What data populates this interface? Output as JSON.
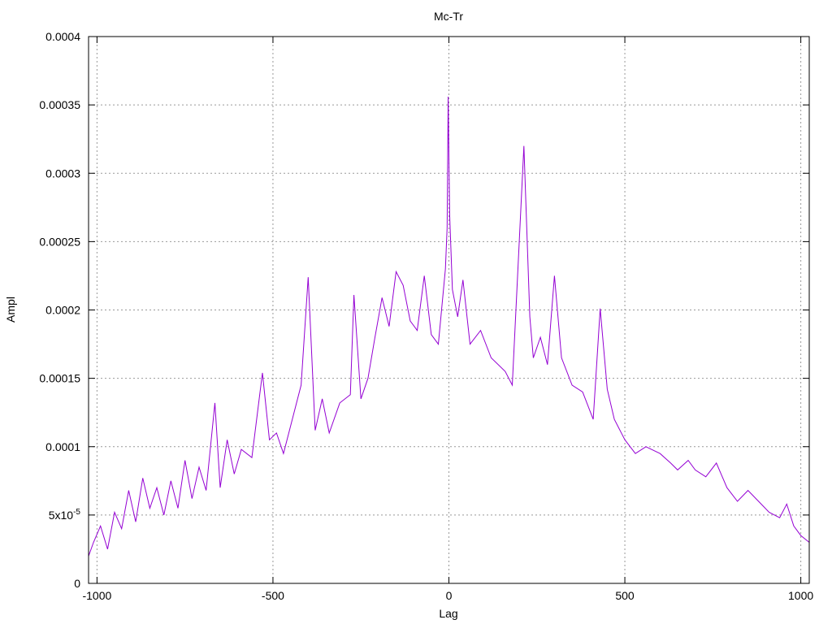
{
  "chart_data": {
    "type": "line",
    "title": "Mc-Tr",
    "xlabel": "Lag",
    "ylabel": "Ampl",
    "xlim": [
      -1024,
      1024
    ],
    "ylim": [
      0,
      0.0004
    ],
    "grid": true,
    "x_ticks": [
      {
        "value": -1000,
        "label": "-1000"
      },
      {
        "value": -500,
        "label": "-500"
      },
      {
        "value": 0,
        "label": "0"
      },
      {
        "value": 500,
        "label": "500"
      },
      {
        "value": 1000,
        "label": "1000"
      }
    ],
    "y_ticks": [
      {
        "value": 0,
        "label": "0"
      },
      {
        "value": 5e-05,
        "label": "5x10",
        "sup": "-5"
      },
      {
        "value": 0.0001,
        "label": "0.0001"
      },
      {
        "value": 0.00015,
        "label": "0.00015"
      },
      {
        "value": 0.0002,
        "label": "0.0002"
      },
      {
        "value": 0.00025,
        "label": "0.00025"
      },
      {
        "value": 0.0003,
        "label": "0.0003"
      },
      {
        "value": 0.00035,
        "label": "0.00035"
      },
      {
        "value": 0.0004,
        "label": "0.0004"
      }
    ],
    "series": [
      {
        "color": "#9400d3",
        "points": [
          [
            -1024,
            2e-05
          ],
          [
            -1010,
            3e-05
          ],
          [
            -990,
            4.2e-05
          ],
          [
            -970,
            2.5e-05
          ],
          [
            -950,
            5.2e-05
          ],
          [
            -930,
            4e-05
          ],
          [
            -910,
            6.8e-05
          ],
          [
            -890,
            4.5e-05
          ],
          [
            -870,
            7.7e-05
          ],
          [
            -850,
            5.5e-05
          ],
          [
            -830,
            7e-05
          ],
          [
            -810,
            5e-05
          ],
          [
            -790,
            7.5e-05
          ],
          [
            -770,
            5.5e-05
          ],
          [
            -750,
            9e-05
          ],
          [
            -730,
            6.2e-05
          ],
          [
            -710,
            8.5e-05
          ],
          [
            -690,
            6.8e-05
          ],
          [
            -665,
            0.000132
          ],
          [
            -650,
            7e-05
          ],
          [
            -630,
            0.000105
          ],
          [
            -610,
            8e-05
          ],
          [
            -590,
            9.8e-05
          ],
          [
            -560,
            9.2e-05
          ],
          [
            -530,
            0.000154
          ],
          [
            -510,
            0.000105
          ],
          [
            -490,
            0.00011
          ],
          [
            -470,
            9.5e-05
          ],
          [
            -450,
            0.000115
          ],
          [
            -420,
            0.000145
          ],
          [
            -400,
            0.000224
          ],
          [
            -380,
            0.000112
          ],
          [
            -360,
            0.000135
          ],
          [
            -340,
            0.00011
          ],
          [
            -310,
            0.000132
          ],
          [
            -280,
            0.000138
          ],
          [
            -270,
            0.000211
          ],
          [
            -250,
            0.000135
          ],
          [
            -230,
            0.00015
          ],
          [
            -210,
            0.00018
          ],
          [
            -190,
            0.000209
          ],
          [
            -170,
            0.000188
          ],
          [
            -150,
            0.000228
          ],
          [
            -130,
            0.000218
          ],
          [
            -110,
            0.000192
          ],
          [
            -90,
            0.000185
          ],
          [
            -70,
            0.000225
          ],
          [
            -50,
            0.000182
          ],
          [
            -30,
            0.000175
          ],
          [
            -10,
            0.00023
          ],
          [
            -5,
            0.00026
          ],
          [
            -2,
            0.000356
          ],
          [
            2,
            0.00027
          ],
          [
            10,
            0.000215
          ],
          [
            25,
            0.000195
          ],
          [
            40,
            0.000222
          ],
          [
            60,
            0.000175
          ],
          [
            90,
            0.000185
          ],
          [
            120,
            0.000165
          ],
          [
            160,
            0.000155
          ],
          [
            180,
            0.000145
          ],
          [
            213,
            0.00032
          ],
          [
            230,
            0.000195
          ],
          [
            240,
            0.000165
          ],
          [
            260,
            0.00018
          ],
          [
            280,
            0.00016
          ],
          [
            300,
            0.000225
          ],
          [
            320,
            0.000165
          ],
          [
            350,
            0.000145
          ],
          [
            380,
            0.00014
          ],
          [
            410,
            0.00012
          ],
          [
            430,
            0.000201
          ],
          [
            450,
            0.000142
          ],
          [
            470,
            0.00012
          ],
          [
            500,
            0.000105
          ],
          [
            530,
            9.5e-05
          ],
          [
            560,
            0.0001
          ],
          [
            600,
            9.5e-05
          ],
          [
            630,
            8.8e-05
          ],
          [
            650,
            8.3e-05
          ],
          [
            680,
            9e-05
          ],
          [
            700,
            8.3e-05
          ],
          [
            730,
            7.8e-05
          ],
          [
            760,
            8.8e-05
          ],
          [
            790,
            7e-05
          ],
          [
            820,
            6e-05
          ],
          [
            850,
            6.8e-05
          ],
          [
            880,
            6e-05
          ],
          [
            910,
            5.2e-05
          ],
          [
            940,
            4.8e-05
          ],
          [
            960,
            5.8e-05
          ],
          [
            980,
            4.2e-05
          ],
          [
            1000,
            3.5e-05
          ],
          [
            1024,
            3e-05
          ]
        ]
      }
    ]
  }
}
